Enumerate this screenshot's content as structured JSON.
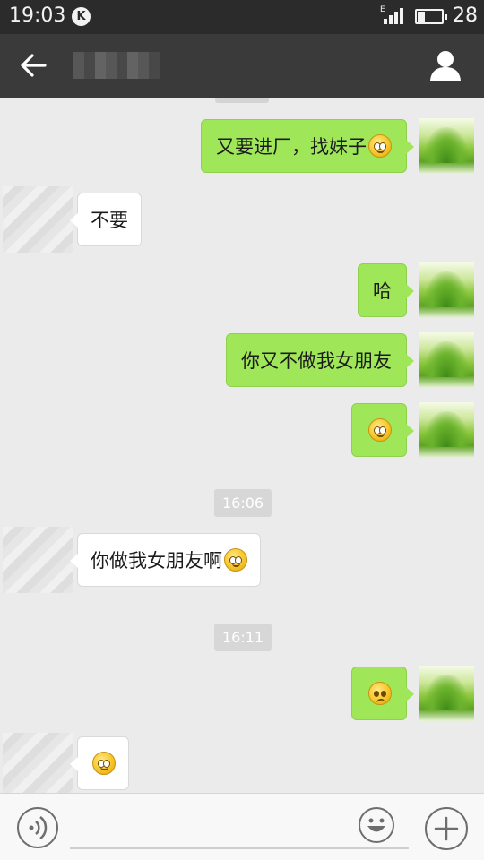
{
  "status_bar": {
    "time": "19:03",
    "k_badge": "K",
    "network": "E",
    "battery_level": "28",
    "battery_fraction": 0.28,
    "signal_bars": 4
  },
  "nav": {
    "back_icon": "arrow-left-icon",
    "profile_icon": "person-icon"
  },
  "colors": {
    "my_bubble": "#9fe658",
    "other_bubble": "#ffffff",
    "chat_background": "#ebebeb",
    "nav_background": "#3a3a3a"
  },
  "messages": [
    {
      "side": "me",
      "text": "又要进厂，找妹子",
      "emoji": "smile"
    },
    {
      "side": "other",
      "text": "不要"
    },
    {
      "side": "me",
      "text": "哈"
    },
    {
      "side": "me",
      "text": "你又不做我女朋友"
    },
    {
      "side": "me",
      "text": "",
      "emoji": "smile"
    },
    {
      "timestamp": "16:06"
    },
    {
      "side": "other",
      "text": "你做我女朋友啊",
      "emoji": "smile"
    },
    {
      "timestamp": "16:11"
    },
    {
      "side": "me",
      "text": "",
      "emoji": "sad"
    },
    {
      "side": "other",
      "text": "",
      "emoji": "smile"
    }
  ],
  "input_bar": {
    "voice_icon": "voice-icon",
    "emoji_icon": "emoji-face-icon",
    "plus_icon": "plus-icon",
    "input_value": ""
  }
}
